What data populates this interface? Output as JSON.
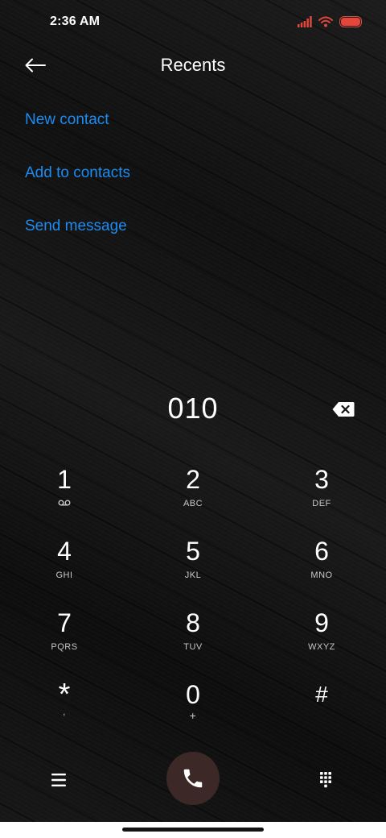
{
  "status_bar": {
    "time": "2:36 AM",
    "icons": [
      "signal-icon",
      "wifi-icon",
      "battery-icon"
    ],
    "accent_color": "#e2473c"
  },
  "header": {
    "title": "Recents",
    "back_icon": "back-arrow-icon"
  },
  "actions": [
    {
      "label": "New contact"
    },
    {
      "label": "Add to contacts"
    },
    {
      "label": "Send message"
    }
  ],
  "dialer": {
    "number": "010",
    "backspace_icon": "backspace-icon"
  },
  "keypad": [
    {
      "digit": "1",
      "letters": "",
      "sub_icon": "voicemail-icon"
    },
    {
      "digit": "2",
      "letters": "ABC"
    },
    {
      "digit": "3",
      "letters": "DEF"
    },
    {
      "digit": "4",
      "letters": "GHI"
    },
    {
      "digit": "5",
      "letters": "JKL"
    },
    {
      "digit": "6",
      "letters": "MNO"
    },
    {
      "digit": "7",
      "letters": "PQRS"
    },
    {
      "digit": "8",
      "letters": "TUV"
    },
    {
      "digit": "9",
      "letters": "WXYZ"
    },
    {
      "digit": "*",
      "letters": ","
    },
    {
      "digit": "0",
      "letters": "+"
    },
    {
      "digit": "#",
      "letters": ""
    }
  ],
  "bottom_bar": {
    "menu_icon": "menu-icon",
    "call_icon": "phone-icon",
    "keypad_icon": "dialpad-icon"
  },
  "colors": {
    "link": "#1d8bf0",
    "call_button": "#3c2927"
  }
}
